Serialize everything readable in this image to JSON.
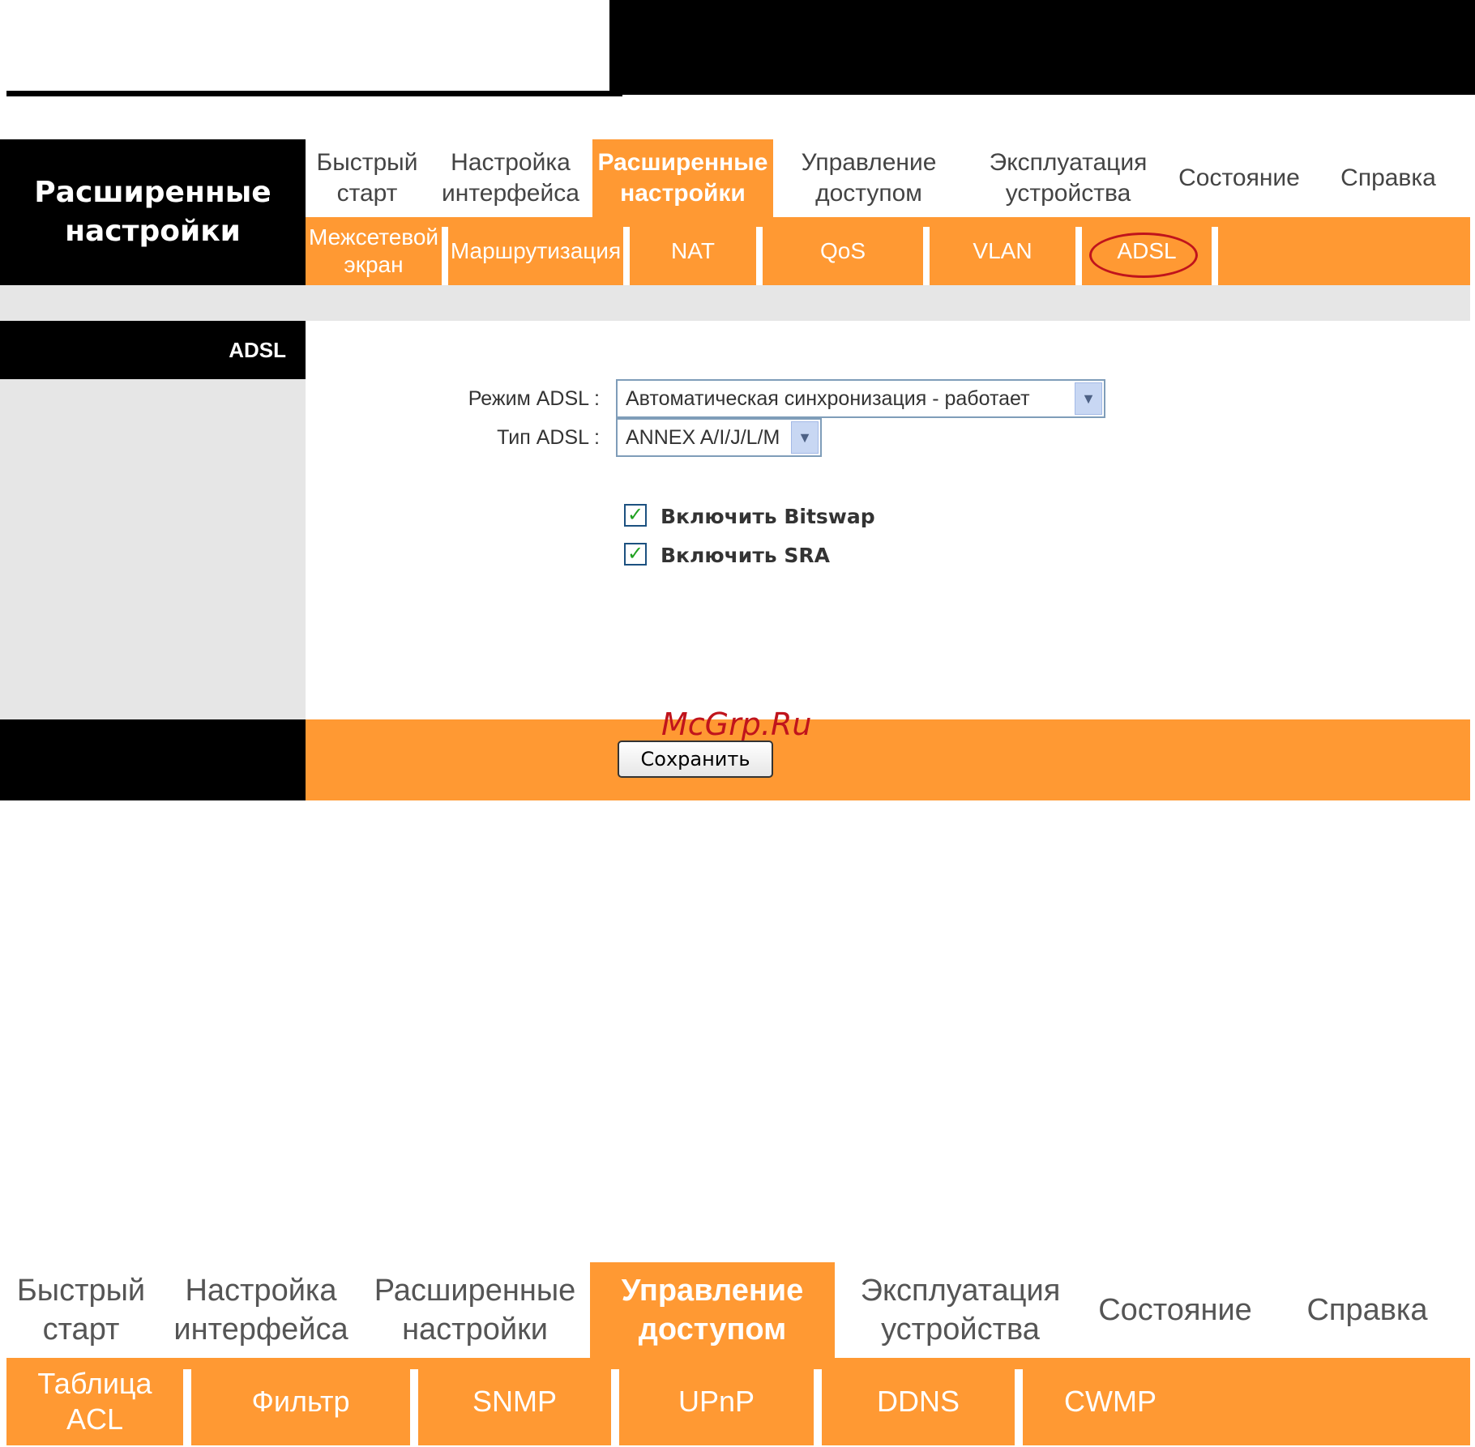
{
  "top_panel": {
    "section_title": "Расширенные настройки",
    "main_tabs": [
      "Быстрый старт",
      "Настройка интерфейса",
      "Расширенные настройки",
      "Управление доступом",
      "Эксплуатация устройства",
      "Состояние",
      "Справка"
    ],
    "active_main_tab": "Расширенные настройки",
    "sub_tabs": [
      "Межсетевой экран",
      "Маршрутизация",
      "NAT",
      "QoS",
      "VLAN",
      "ADSL"
    ],
    "active_sub_tab": "ADSL",
    "sidebar_label": "ADSL",
    "form": {
      "mode_label": "Режим ADSL",
      "mode_value": "Автоматическая синхронизация - работает",
      "type_label": "Тип ADSL",
      "type_value": "ANNEX A/I/J/L/M",
      "bitswap_label": "Включить Bitswap",
      "bitswap_checked": true,
      "sra_label": "Включить SRA",
      "sra_checked": true,
      "colon": ":",
      "save_label": "Сохранить"
    },
    "watermark": "McGrp.Ru"
  },
  "bottom_panel": {
    "main_tabs": [
      "Быстрый старт",
      "Настройка интерфейса",
      "Расширенные настройки",
      "Управление доступом",
      "Эксплуатация устройства",
      "Состояние",
      "Справка"
    ],
    "active_main_tab": "Управление доступом",
    "sub_tabs": [
      "Таблица ACL",
      "Фильтр",
      "SNMP",
      "UPnP",
      "DDNS",
      "CWMP"
    ]
  },
  "colors": {
    "accent_orange": "#ff9933",
    "black": "#000000",
    "gray_panel": "#e6e6e6",
    "highlight_red": "#c0141c",
    "check_green": "#21a121"
  },
  "icons": {
    "dropdown": "chevron-down-icon",
    "checkbox": "checkmark-icon"
  }
}
